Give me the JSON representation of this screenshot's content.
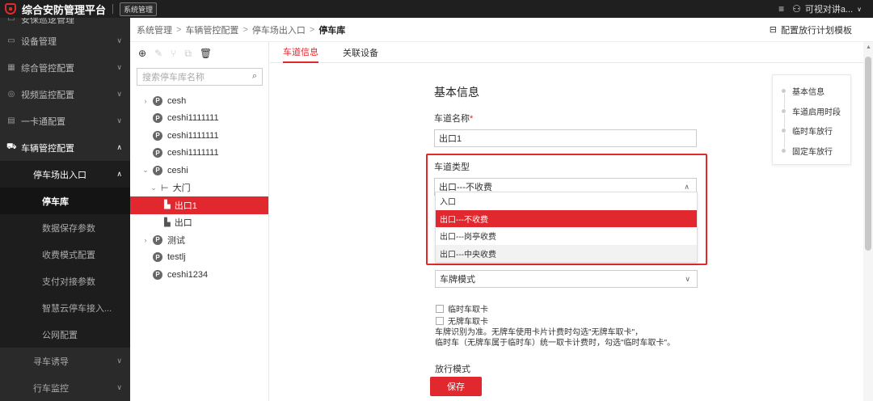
{
  "app": {
    "title": "综合安防管理平台",
    "system_button": "系统管理",
    "user_name": "可视对讲a..."
  },
  "sidebar": {
    "top_cut": "安保巡逻管理",
    "items": [
      {
        "label": "设备管理",
        "icon": "device-icon"
      },
      {
        "label": "综合管控配置",
        "icon": "grid-icon"
      },
      {
        "label": "视频监控配置",
        "icon": "camera-icon"
      },
      {
        "label": "一卡通配置",
        "icon": "card-icon"
      },
      {
        "label": "车辆管控配置",
        "icon": "car-icon"
      }
    ],
    "sub_parent": "停车场出入口",
    "sub_items": [
      "停车库",
      "数据保存参数",
      "收费模式配置",
      "支付对接参数",
      "智慧云停车接入...",
      "公网配置"
    ],
    "more_items": [
      "寻车诱导",
      "行车监控"
    ]
  },
  "breadcrumb": [
    "系统管理",
    "车辆管控配置",
    "停车场出入口",
    "停车库"
  ],
  "plan_button": "配置放行计划模板",
  "tree": {
    "search_placeholder": "搜索停车库名称",
    "nodes": [
      "cesh",
      "ceshi1111111",
      "ceshi1111111",
      "ceshi1111111",
      "ceshi",
      "大门",
      "出口1",
      "出口",
      "测试",
      "testlj",
      "ceshi1234"
    ],
    "badge": "P"
  },
  "tabs": [
    "车道信息",
    "关联设备"
  ],
  "form": {
    "section_title": "基本信息",
    "lane_name_label": "车道名称",
    "required_mark": "*",
    "lane_name_value": "出口1",
    "lane_type_label": "车道类型",
    "lane_type_value": "出口---不收费",
    "lane_type_options": [
      "入口",
      "出口---不收费",
      "出口---岗亭收费",
      "出口---中央收费"
    ],
    "recognition_value": "车牌模式",
    "checkbox1": "临时车取卡",
    "checkbox2": "无牌车取卡",
    "hint_line1": "车牌识别为准。无牌车使用卡片计费时勾选\"无牌车取卡\"，",
    "hint_line2": "临时车（无牌车属于临时车）统一取卡计费时，勾选\"临时车取卡\"。",
    "release_mode_label": "放行模式",
    "save_label": "保存"
  },
  "anchor_nav": [
    "基本信息",
    "车道启用时段",
    "临时车放行",
    "固定车放行"
  ],
  "colors": {
    "accent": "#e0282e",
    "sidebar_bg": "#2a2a2a",
    "topbar_bg": "#1f1f1f"
  }
}
